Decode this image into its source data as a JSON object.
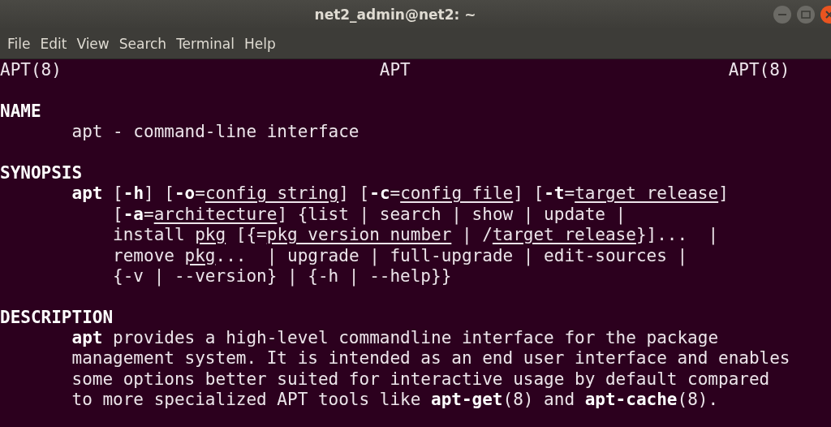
{
  "window": {
    "title": "net2_admin@net2: ~"
  },
  "menu": [
    "File",
    "Edit",
    "View",
    "Search",
    "Terminal",
    "Help"
  ],
  "man_page": {
    "header": {
      "left": "APT(8)",
      "center": "APT",
      "right": "APT(8)"
    },
    "sections": [
      {
        "heading": "NAME",
        "lines": [
          "apt - command-line interface"
        ]
      },
      {
        "heading": "SYNOPSIS",
        "hanging_indent": true,
        "lines": [
          "**apt** [**-h**] [**-o**=*config_string*] [**-c**=*config_file*] [**-t**=*target_release*]",
          "[**-a**=*architecture*] {list | search | show | update |",
          "install *pkg* [{=*pkg_version_number* | /*target_release*}]...  |",
          "remove *pkg*...  | upgrade | full-upgrade | edit-sources |",
          "{-v | --version} | {-h | --help}}"
        ]
      },
      {
        "heading": "DESCRIPTION",
        "hanging_indent": false,
        "lines": [
          "**apt** provides a high-level commandline interface for the package",
          "management system. It is intended as an end user interface and enables",
          "some options better suited for interactive usage by default compared",
          "to more specialized APT tools like **apt-get**(8) and **apt-cache**(8)."
        ]
      }
    ]
  }
}
